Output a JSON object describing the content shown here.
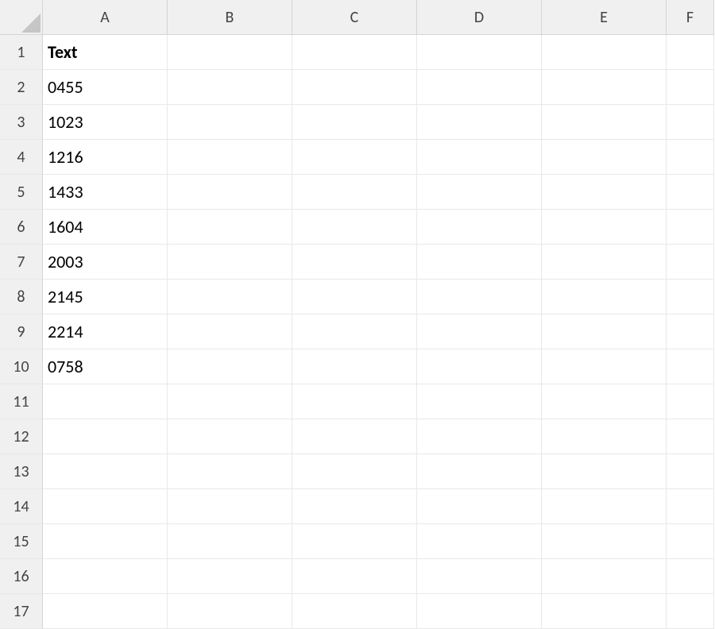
{
  "columns": [
    "A",
    "B",
    "C",
    "D",
    "E",
    "F"
  ],
  "rows": [
    "1",
    "2",
    "3",
    "4",
    "5",
    "6",
    "7",
    "8",
    "9",
    "10",
    "11",
    "12",
    "13",
    "14",
    "15",
    "16",
    "17"
  ],
  "cells": {
    "A1": {
      "value": "Text",
      "bold": true
    },
    "A2": {
      "value": "0455"
    },
    "A3": {
      "value": "1023"
    },
    "A4": {
      "value": "1216"
    },
    "A5": {
      "value": "1433"
    },
    "A6": {
      "value": "1604"
    },
    "A7": {
      "value": "2003"
    },
    "A8": {
      "value": "2145"
    },
    "A9": {
      "value": "2214"
    },
    "A10": {
      "value": "0758"
    }
  }
}
